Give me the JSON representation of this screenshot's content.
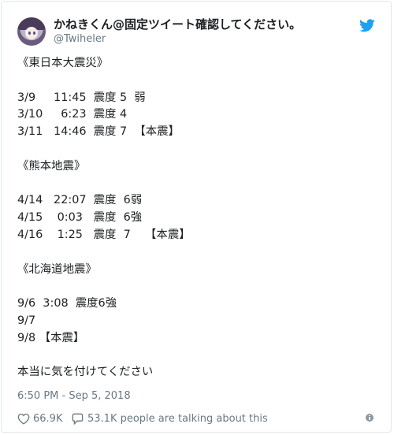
{
  "tweet": {
    "display_name": "かねきくん@固定ツイート確認してください。",
    "handle": "@Twiheler",
    "text_lines": [
      "《東日本大震災》",
      "",
      "3/9     11:45  震度 5  弱",
      "3/10     6:23  震度 4",
      "3/11   14:46  震度 7  【本震】",
      "",
      "《熊本地震》",
      "",
      "4/14   22:07  震度  6弱",
      "4/15    0:03   震度  6強",
      "4/16    1:25   震度  7    【本震】",
      "",
      "《北海道地震》",
      "",
      "9/6  3:08  震度6強",
      "9/7",
      "9/8 【本震】",
      "",
      "本当に気を付けてください"
    ],
    "timestamp": "6:50 PM - Sep 5, 2018",
    "likes_count": "66.9K",
    "talking_text": "53.1K people are talking about this"
  },
  "icons": {
    "avatar": "avatar",
    "brand": "twitter-bird-icon",
    "like": "heart-icon",
    "reply": "speech-bubble-icon",
    "info": "info-icon"
  },
  "colors": {
    "brand_blue": "#1da1f2",
    "text": "#1c2022",
    "muted": "#697882",
    "border": "#e1e8ed"
  }
}
